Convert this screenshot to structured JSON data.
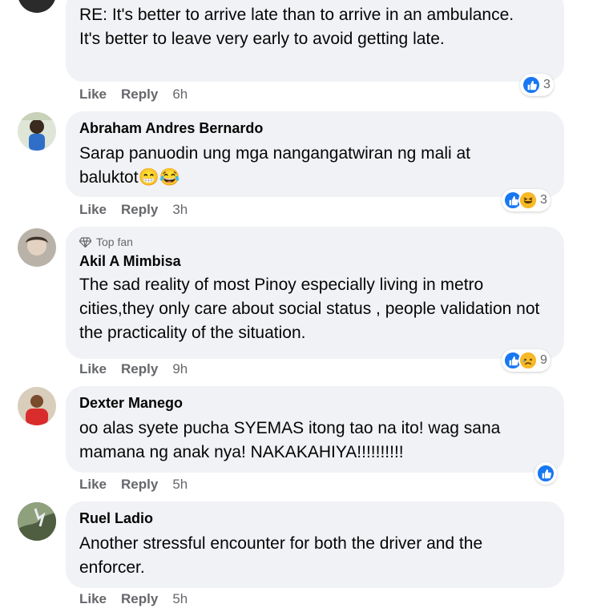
{
  "colors": {
    "bubble": "#f0f2f5",
    "like": "#1877f2",
    "meta": "#65676b",
    "emoji": "#f7b928"
  },
  "actions": {
    "like": "Like",
    "reply": "Reply"
  },
  "comments": [
    {
      "name": "",
      "badge": "",
      "text": "RE: It's better to arrive late than to arrive in an ambulance.\nIt's better to leave very early to avoid getting late.",
      "time": "6h",
      "reactions": [
        "like-icon"
      ],
      "count": "3"
    },
    {
      "name": "Abraham Andres Bernardo",
      "badge": "",
      "text": "Sarap panuodin ung mga nangangatwiran ng mali at baluktot😁😂",
      "time": "3h",
      "reactions": [
        "like-icon",
        "haha-icon"
      ],
      "count": "3"
    },
    {
      "name": "Akil A Mimbisa",
      "badge": "Top fan",
      "text": "The sad reality of most Pinoy especially living in metro cities,they only care about social status , people validation not the practicality of the situation.",
      "time": "9h",
      "reactions": [
        "like-icon",
        "sad-icon"
      ],
      "count": "9"
    },
    {
      "name": "Dexter Manego",
      "badge": "",
      "text": "oo alas syete pucha SYEMAS itong tao na ito! wag sana mamana ng anak nya! NAKAKAHIYA!!!!!!!!!!",
      "time": "5h",
      "reactions": [
        "like-icon"
      ],
      "count": ""
    },
    {
      "name": "Ruel Ladio",
      "badge": "",
      "text": "Another stressful encounter for both the driver and the enforcer.",
      "time": "5h",
      "reactions": [],
      "count": ""
    }
  ]
}
